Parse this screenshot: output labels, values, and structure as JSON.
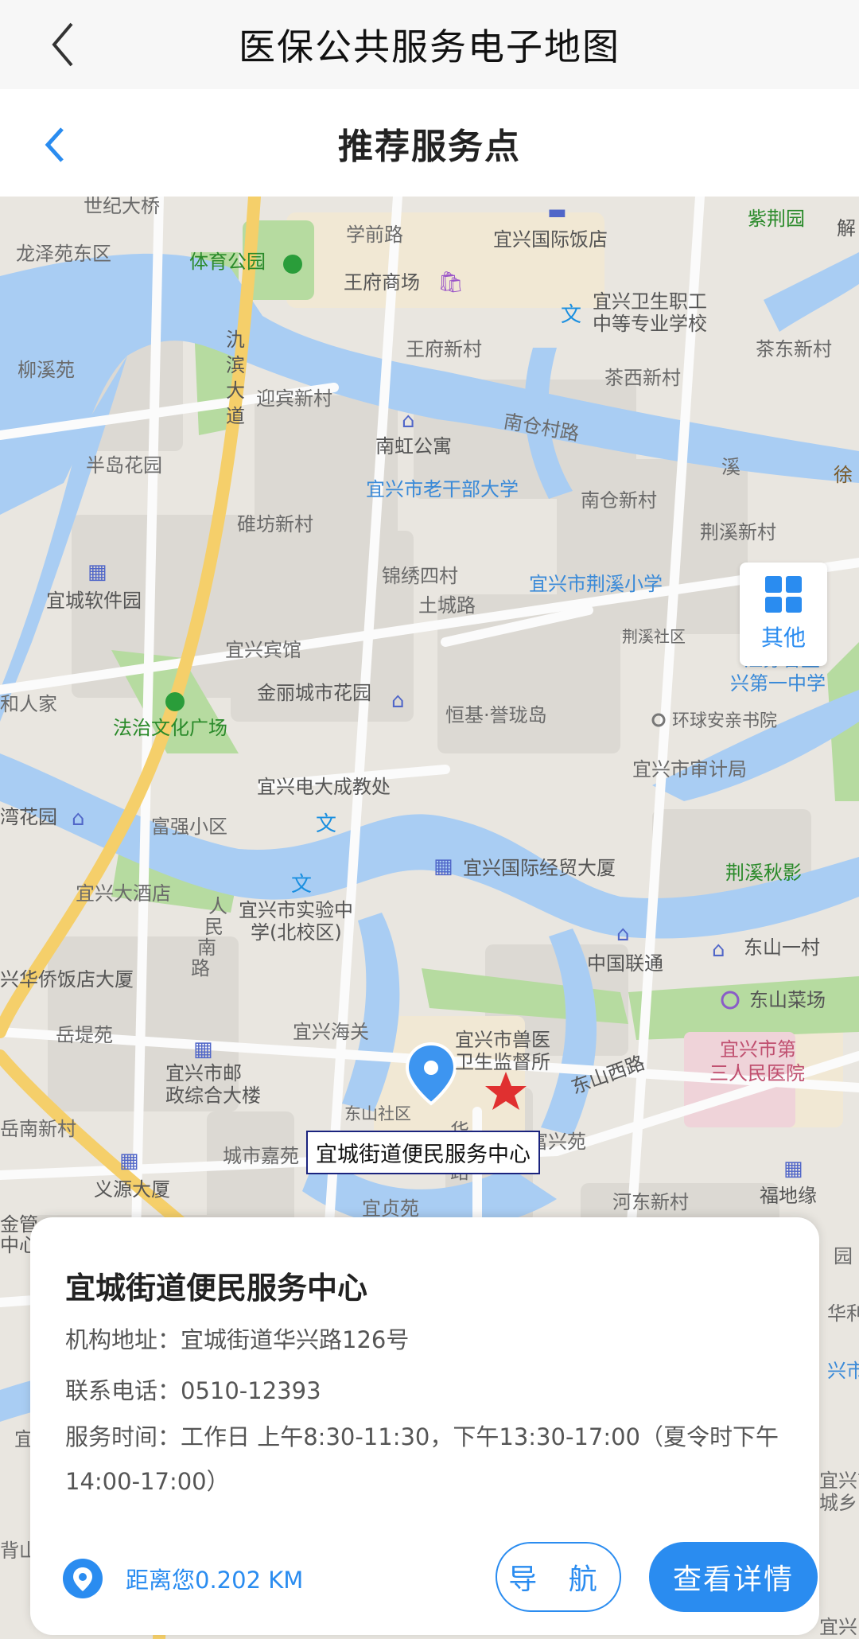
{
  "top_bar": {
    "title": "医保公共服务电子地图"
  },
  "sub_bar": {
    "title": "推荐服务点"
  },
  "map": {
    "other_label": "其他",
    "callout": "宜城街道便民服务中心",
    "labels": [
      "世纪大桥",
      "学前路",
      "宜兴国际饭店",
      "紫荆园",
      "解",
      "龙泽苑东区",
      "体育公园",
      "王府商场",
      "宜兴卫生职工",
      "中等专业学校",
      "王府新村",
      "茶东新村",
      "柳溪苑",
      "氿",
      "滨",
      "大",
      "道",
      "迎宾新村",
      "茶西新村",
      "南仓村路",
      "南虹公寓",
      "半岛花园",
      "宜兴市老干部大学",
      "南仓新村",
      "溪",
      "徐",
      "碓坊新村",
      "荆溪新村",
      "锦绣四村",
      "宜城软件园",
      "宜兴市荆溪小学",
      "土城路",
      "荆溪社区",
      "宜兴宾馆",
      "江苏省宜",
      "兴第一中学",
      "和人家",
      "金丽城市花园",
      "恒基·誉珑岛",
      "环球安亲书院",
      "法治文化广场",
      "宜兴市审计局",
      "宜兴电大成教处",
      "湾花园",
      "富强小区",
      "荆溪秋影",
      "宜兴国际经贸大厦",
      "宜兴大酒店",
      "宜兴市实验中",
      "学(北校区)",
      "人",
      "民",
      "南",
      "路",
      "东山一村",
      "中国联通",
      "兴华侨饭店大厦",
      "东山菜场",
      "岳堤苑",
      "宜兴海关",
      "宜兴市兽医",
      "卫生监督所",
      "宜兴市第",
      "三人民医院",
      "东山西路",
      "宜兴市邮",
      "政综合大楼",
      "东山社区",
      "华",
      "兴",
      "路",
      "富兴苑",
      "岳南新村",
      "城市嘉苑",
      "义源大厦",
      "河东新村",
      "福地缘",
      "宜贞苑",
      "金管",
      "中心",
      "园",
      "华利",
      "兴市",
      "宜兴市",
      "城乡",
      "宜",
      "背山",
      "宜兴"
    ]
  },
  "card": {
    "name": "宜城街道便民服务中心",
    "address": "机构地址：宜城街道华兴路126号",
    "phone": "联系电话：0510-12393",
    "hours": "服务时间：工作日 上午8:30-11:30，下午13:30-17:00（夏令时下午14:00-17:00）",
    "distance": "距离您0.202 KM",
    "nav_label": "导 航",
    "detail_label": "查看详情"
  },
  "colors": {
    "accent": "#2a8cf0",
    "water": "#a9cdf3",
    "park": "#b6dba0",
    "road": "#fbfbfb",
    "main_road": "#f5cf6a"
  }
}
